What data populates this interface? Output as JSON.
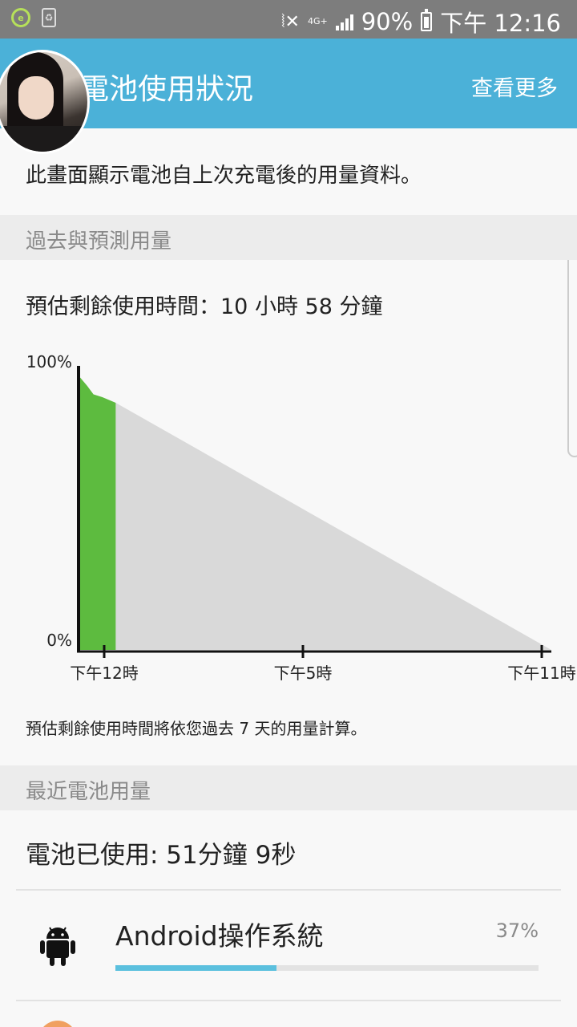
{
  "status_bar": {
    "network": "4G+",
    "battery_percent": "90%",
    "time": "下午 12:16"
  },
  "app_bar": {
    "title": "電池使用狀況",
    "more_label": "查看更多"
  },
  "description": "此畫面顯示電池自上次充電後的用量資料。",
  "sections": {
    "past_predicted": "過去與預測用量",
    "recent_usage": "最近電池用量"
  },
  "estimate_text": "預估剩餘使用時間：10 小時 58 分鐘",
  "chart_data": {
    "type": "area",
    "y_tick_labels": [
      "100%",
      "0%"
    ],
    "x_tick_labels": [
      "下午12時",
      "下午5時",
      "下午11時"
    ],
    "ylim": [
      0,
      100
    ],
    "series": [
      {
        "kind": "actual",
        "color": "#5dbb3f",
        "points": [
          [
            0,
            97
          ],
          [
            0.08,
            94
          ],
          [
            0.15,
            91
          ],
          [
            0.25,
            90
          ],
          [
            0.4,
            88
          ]
        ]
      },
      {
        "kind": "predicted",
        "color": "#d9d9d9",
        "points": [
          [
            0.4,
            88
          ],
          [
            5.3,
            0
          ]
        ]
      }
    ],
    "x_range": [
      0,
      5.3
    ]
  },
  "note": "預估剩餘使用時間將依您過去 7 天的用量計算。",
  "battery_used_text": "電池已使用: 51分鐘 9秒",
  "apps": [
    {
      "name": "Android操作系統",
      "percent_label": "37%",
      "fraction": 0.38,
      "icon": "android-icon"
    }
  ]
}
